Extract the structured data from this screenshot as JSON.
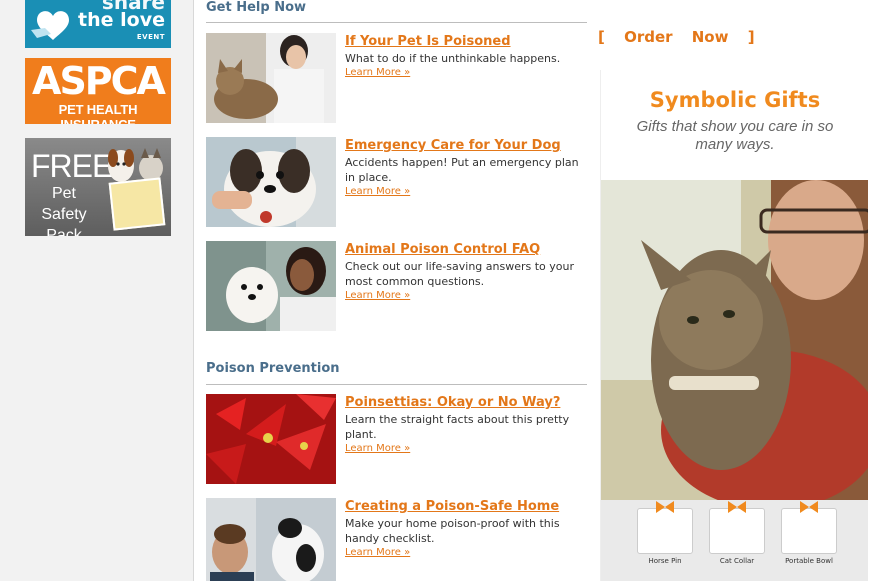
{
  "left_promos": {
    "share_love": {
      "line1": "share",
      "line2": "the love",
      "line3": "EVENT"
    },
    "aspca_insurance": {
      "logo": "ASPCA",
      "sub": "PET HEALTH INSURANCE"
    },
    "safety_pack": {
      "line1": "FREE",
      "line2": "Pet Safety Pack"
    }
  },
  "get_help": {
    "title": "Get Help Now",
    "items": [
      {
        "title": "If Your Pet Is Poisoned",
        "desc": "What to do if the unthinkable happens.",
        "more": "Learn More »"
      },
      {
        "title": "Emergency Care for Your Dog",
        "desc": "Accidents happen! Put an emergency plan in place.",
        "more": "Learn More »"
      },
      {
        "title": "Animal Poison Control FAQ",
        "desc": "Check out our life-saving answers to your most common questions.",
        "more": "Learn More »"
      }
    ]
  },
  "prevention": {
    "title": "Poison Prevention",
    "items": [
      {
        "title": "Poinsettias: Okay or No Way?",
        "desc": "Learn the straight facts about this pretty plant.",
        "more": "Learn More »"
      },
      {
        "title": "Creating a Poison-Safe Home",
        "desc": "Make your home poison-proof with this handy checklist.",
        "more": "Learn More »"
      }
    ]
  },
  "order": {
    "label": "[ Order Now ]"
  },
  "gifts_ad": {
    "title": "Symbolic Gifts",
    "subtitle": "Gifts that show you care in so many ways.",
    "products": [
      "Horse Pin",
      "Cat Collar",
      "Portable Bowl"
    ]
  },
  "colors": {
    "accent": "#e37719",
    "section": "#4a6e8b",
    "gift_orange": "#f08a1e"
  }
}
